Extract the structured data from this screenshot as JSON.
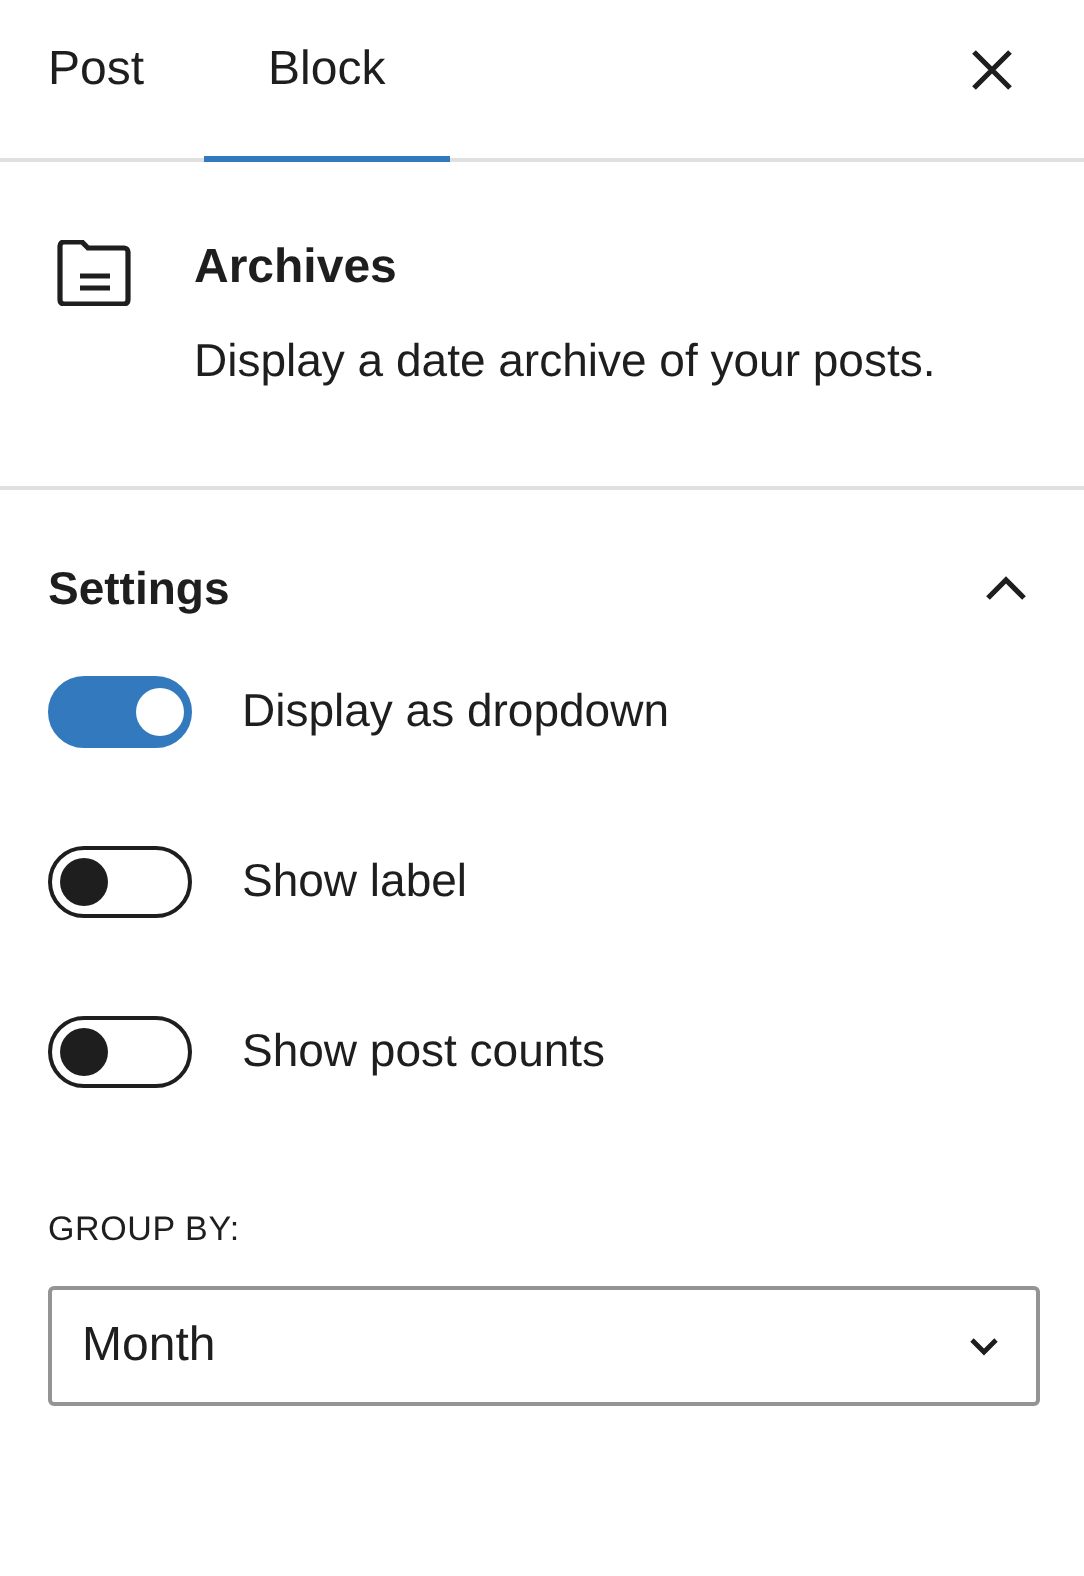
{
  "tabs": [
    {
      "label": "Post",
      "selected": false
    },
    {
      "label": "Block",
      "selected": true
    }
  ],
  "block": {
    "title": "Archives",
    "description": "Display a date archive of your posts."
  },
  "settings": {
    "title": "Settings",
    "expanded": true,
    "toggles": [
      {
        "label": "Display as dropdown",
        "on": true
      },
      {
        "label": "Show label",
        "on": false
      },
      {
        "label": "Show post counts",
        "on": false
      }
    ],
    "group_by": {
      "label": "GROUP BY:",
      "value": "Month"
    }
  }
}
